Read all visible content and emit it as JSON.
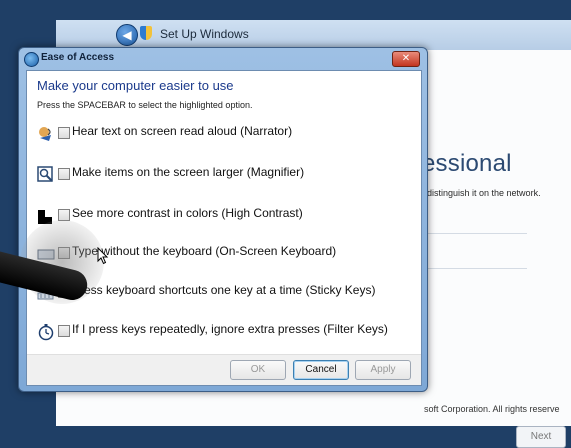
{
  "background_window": {
    "title": "Set Up Windows",
    "heading_fragment": "essional",
    "description_fragment": "distinguish it on the network.",
    "copyright_fragment": "soft Corporation.  All rights reserve",
    "next_button": "Next"
  },
  "dialog": {
    "title": "Ease of Access",
    "close_label": "✕",
    "heading": "Make your computer easier to use",
    "instruction": "Press the SPACEBAR to select the highlighted option.",
    "options": [
      {
        "label": "Hear text on screen read aloud (Narrator)",
        "icon": "narrator-icon",
        "checked": false
      },
      {
        "label": "Make items on the screen larger (Magnifier)",
        "icon": "magnifier-icon",
        "checked": false
      },
      {
        "label": "See more contrast in colors (High Contrast)",
        "icon": "high-contrast-icon",
        "checked": false
      },
      {
        "label": "Type without the keyboard (On-Screen Keyboard)",
        "icon": "keyboard-icon",
        "checked": false
      },
      {
        "label": "Press keyboard shortcuts one key at a time (Sticky Keys)",
        "icon": "sticky-keys-icon",
        "checked": false
      },
      {
        "label": "If I press keys repeatedly, ignore extra presses (Filter Keys)",
        "icon": "stopwatch-icon",
        "checked": false
      }
    ],
    "buttons": {
      "ok": "OK",
      "cancel": "Cancel",
      "apply": "Apply"
    }
  },
  "colors": {
    "heading_blue": "#1b3a8c",
    "title_bar": "#9ec0e4",
    "close_red": "#c3351f"
  }
}
